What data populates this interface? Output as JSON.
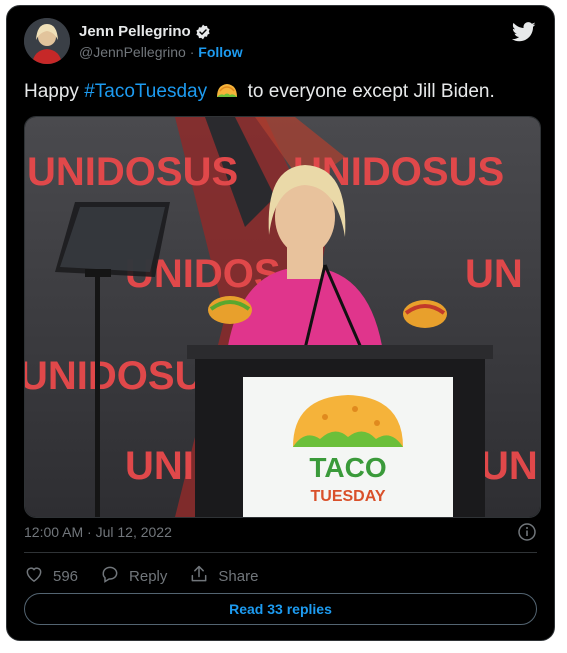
{
  "author": {
    "display_name": "Jenn Pellegrino",
    "handle": "@JennPellegrino",
    "separator": "·",
    "follow_label": "Follow",
    "verified": true
  },
  "tweet": {
    "text_before": "Happy ",
    "hashtag": "#TacoTuesday",
    "emoji": "taco-emoji",
    "text_after": " to everyone except Jill Biden.",
    "timestamp": "12:00 AM · Jul 12, 2022"
  },
  "media": {
    "backdrop_text_1": "UNIDOSUS",
    "backdrop_text_2": "UNIDOS",
    "backdrop_text_3": "UN",
    "podium_line1": "TACO",
    "podium_line2": "TUESDAY"
  },
  "actions": {
    "likes": "596",
    "reply_label": "Reply",
    "share_label": "Share"
  },
  "footer": {
    "read_replies": "Read 33 replies"
  },
  "colors": {
    "link": "#1d9bf0",
    "background": "#000000",
    "muted": "#71767b"
  }
}
